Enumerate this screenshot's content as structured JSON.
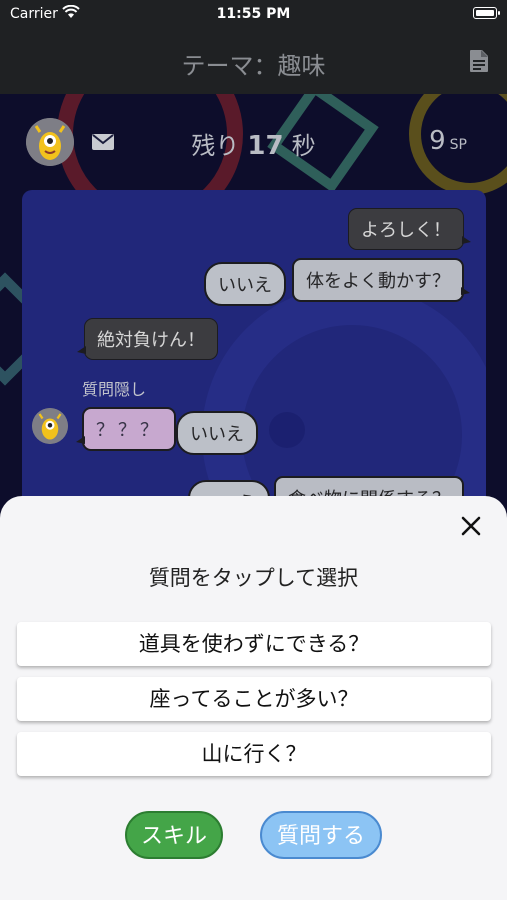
{
  "status": {
    "carrier": "Carrier",
    "time": "11:55 PM"
  },
  "nav": {
    "title": "テーマ：趣味"
  },
  "game": {
    "remaining_prefix": "残り",
    "remaining_value": "17",
    "remaining_suffix": "秒",
    "sp_value": "9",
    "sp_unit": "SP"
  },
  "chat": {
    "messages": [
      {
        "text": "よろしく！"
      },
      {
        "answer": "いいえ",
        "text": "体をよく動かす？"
      },
      {
        "text": "絶対負けん！"
      },
      {
        "label": "質問隠し"
      },
      {
        "text": "？？？",
        "answer": "いいえ"
      },
      {
        "answer": "いいえ",
        "text": "食べ物に関係する？"
      }
    ]
  },
  "sheet": {
    "title": "質問をタップして選択",
    "options": [
      "道具を使わずにできる？",
      "座ってることが多い？",
      "山に行く？"
    ],
    "skill_label": "スキル",
    "ask_label": "質問する"
  },
  "colors": {
    "chat_bg": "#21277a",
    "skill_button": "#44a548",
    "ask_button": "#8cc4f4",
    "nav_bg": "#1f2123"
  }
}
